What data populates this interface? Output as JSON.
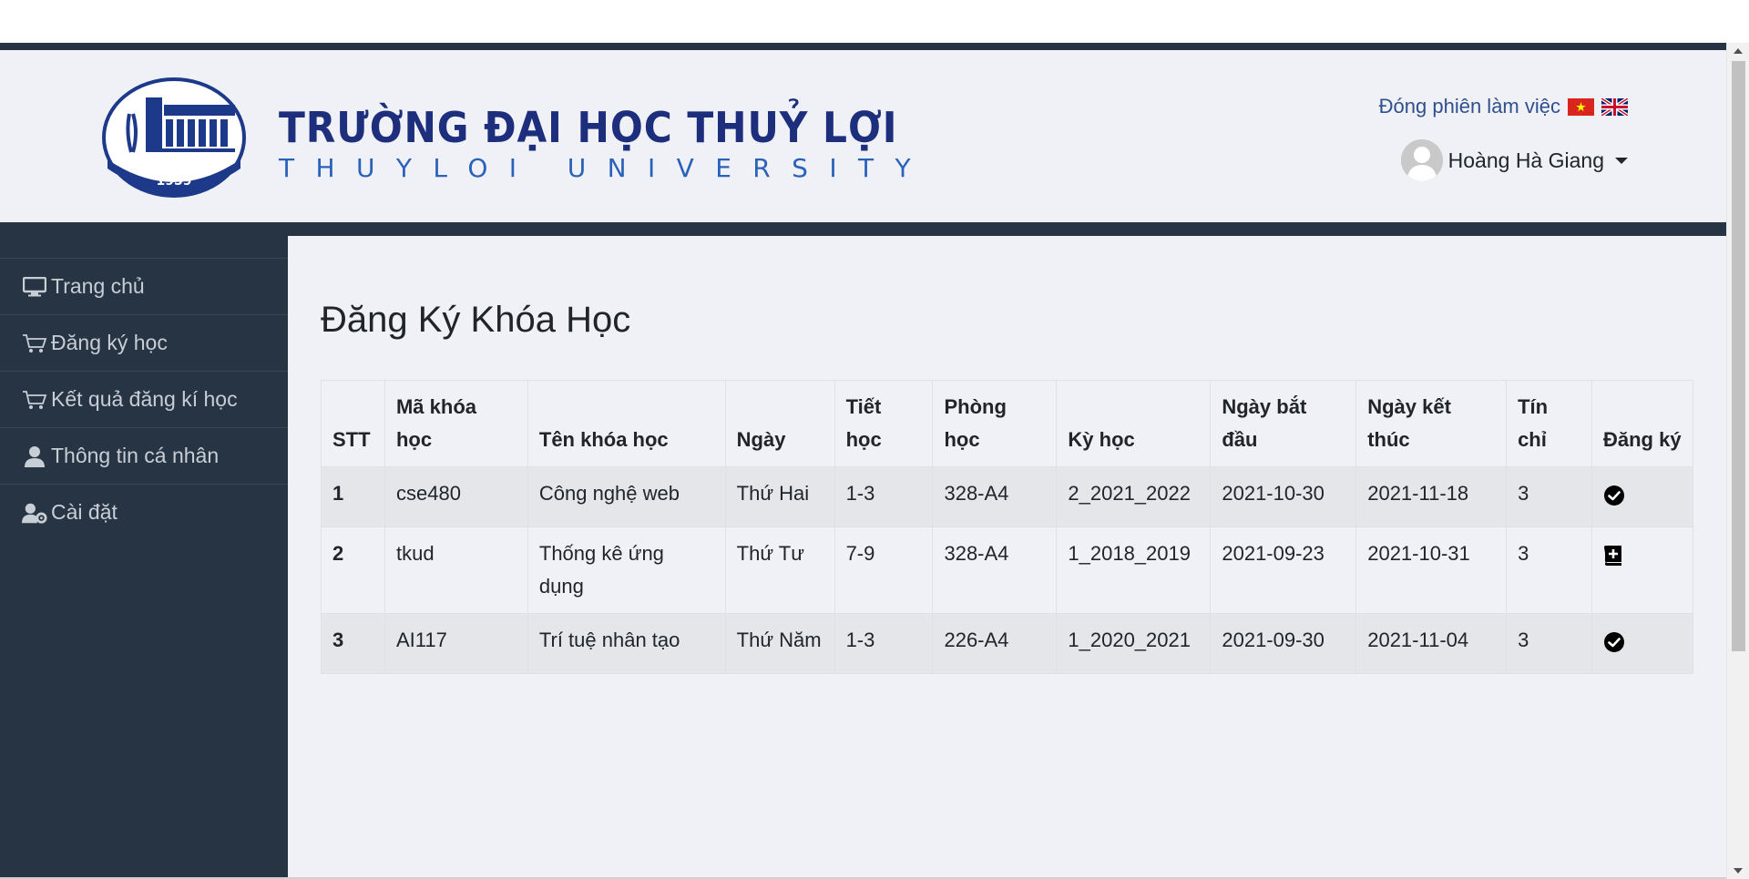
{
  "header": {
    "brand_vn": "TRƯỜNG ĐẠI HỌC THUỶ LỢI",
    "brand_en": "THUYLOI UNIVERSITY",
    "logo_year": "1959",
    "logout_label": "Đóng phiên làm việc",
    "user_name": "Hoàng Hà Giang"
  },
  "sidebar": {
    "items": [
      {
        "label": "Trang chủ",
        "icon": "desktop-icon"
      },
      {
        "label": "Đăng ký học",
        "icon": "cart-icon"
      },
      {
        "label": "Kết quả đăng kí học",
        "icon": "cart-icon"
      },
      {
        "label": "Thông tin cá nhân",
        "icon": "user-icon"
      },
      {
        "label": "Cài đặt",
        "icon": "user-cog-icon"
      }
    ]
  },
  "main": {
    "title": "Đăng Ký Khóa Học",
    "columns": [
      "STT",
      "Mã khóa học",
      "Tên khóa học",
      "Ngày",
      "Tiết học",
      "Phòng học",
      "Kỳ học",
      "Ngày bắt đầu",
      "Ngày kết thúc",
      "Tín chỉ",
      "Đăng ký"
    ],
    "rows": [
      {
        "stt": "1",
        "code": "cse480",
        "name": "Công nghệ web",
        "day": "Thứ Hai",
        "period": "1-3",
        "room": "328-A4",
        "term": "2_2021_2022",
        "start": "2021-10-30",
        "end": "2021-11-18",
        "credits": "3",
        "action_icon": "check-circle-icon"
      },
      {
        "stt": "2",
        "code": "tkud",
        "name": "Thống kê ứng dụng",
        "day": "Thứ Tư",
        "period": "7-9",
        "room": "328-A4",
        "term": "1_2018_2019",
        "start": "2021-09-23",
        "end": "2021-10-31",
        "credits": "3",
        "action_icon": "book-plus-icon"
      },
      {
        "stt": "3",
        "code": "AI117",
        "name": "Trí tuệ nhân tạo",
        "day": "Thứ Năm",
        "period": "1-3",
        "room": "226-A4",
        "term": "1_2020_2021",
        "start": "2021-09-30",
        "end": "2021-11-04",
        "credits": "3",
        "action_icon": "check-circle-icon"
      }
    ]
  },
  "colors": {
    "sidebar_bg": "#273444",
    "content_bg": "#eff1f6",
    "brand_dark": "#1d2f7c",
    "brand_light": "#2b62b9"
  }
}
